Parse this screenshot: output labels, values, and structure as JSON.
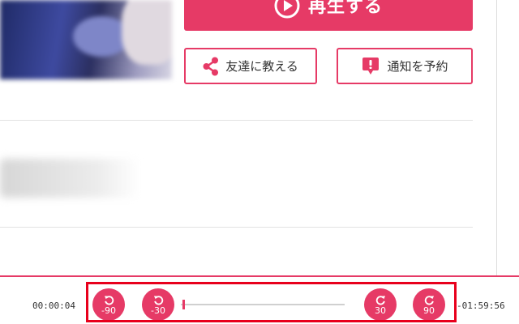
{
  "actions": {
    "play_label": "再生する",
    "share_label": "友達に教える",
    "notify_label": "通知を予約"
  },
  "player": {
    "current_time": "00:00:04",
    "total_time": "-01:59:56",
    "progress": 0.01,
    "seek_buttons": [
      {
        "label": "-90",
        "direction": "back"
      },
      {
        "label": "-30",
        "direction": "back"
      },
      {
        "label": "30",
        "direction": "forward"
      },
      {
        "label": "90",
        "direction": "forward"
      }
    ]
  },
  "colors": {
    "accent": "#e63a66",
    "highlight": "#e8001c"
  },
  "icons": {
    "play": "play-circle-icon",
    "share": "share-icon",
    "notify": "notification-bell-icon",
    "rewind": "rotate-left-icon",
    "forward": "rotate-right-icon"
  }
}
